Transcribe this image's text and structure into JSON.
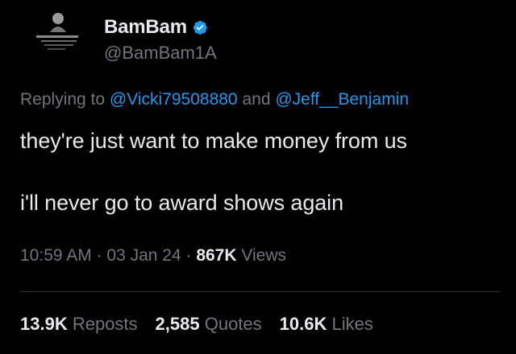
{
  "author": {
    "display_name": "BamBam",
    "handle": "@BamBam1A",
    "verified": true,
    "verified_color": "#1d9bf0",
    "avatar_icon": "avatar-image"
  },
  "reply": {
    "prefix": "Replying to ",
    "mention1": "@Vicki79508880",
    "conjunction": " and ",
    "mention2": "@Jeff__Benjamin"
  },
  "tweet": {
    "line1": "they're just want to make money from us",
    "line2": "i'll never go to award shows again"
  },
  "meta": {
    "time": "10:59 AM",
    "sep1": " · ",
    "date": "03 Jan 24",
    "sep2": " · ",
    "views_count": "867K",
    "views_label": " Views"
  },
  "stats": {
    "reposts_count": "13.9K",
    "reposts_label": " Reposts",
    "quotes_count": "2,585",
    "quotes_label": " Quotes",
    "likes_count": "10.6K",
    "likes_label": " Likes"
  },
  "colors": {
    "background": "#000000",
    "text": "#e7e9ea",
    "muted": "#71767b",
    "link": "#1d9bf0"
  }
}
